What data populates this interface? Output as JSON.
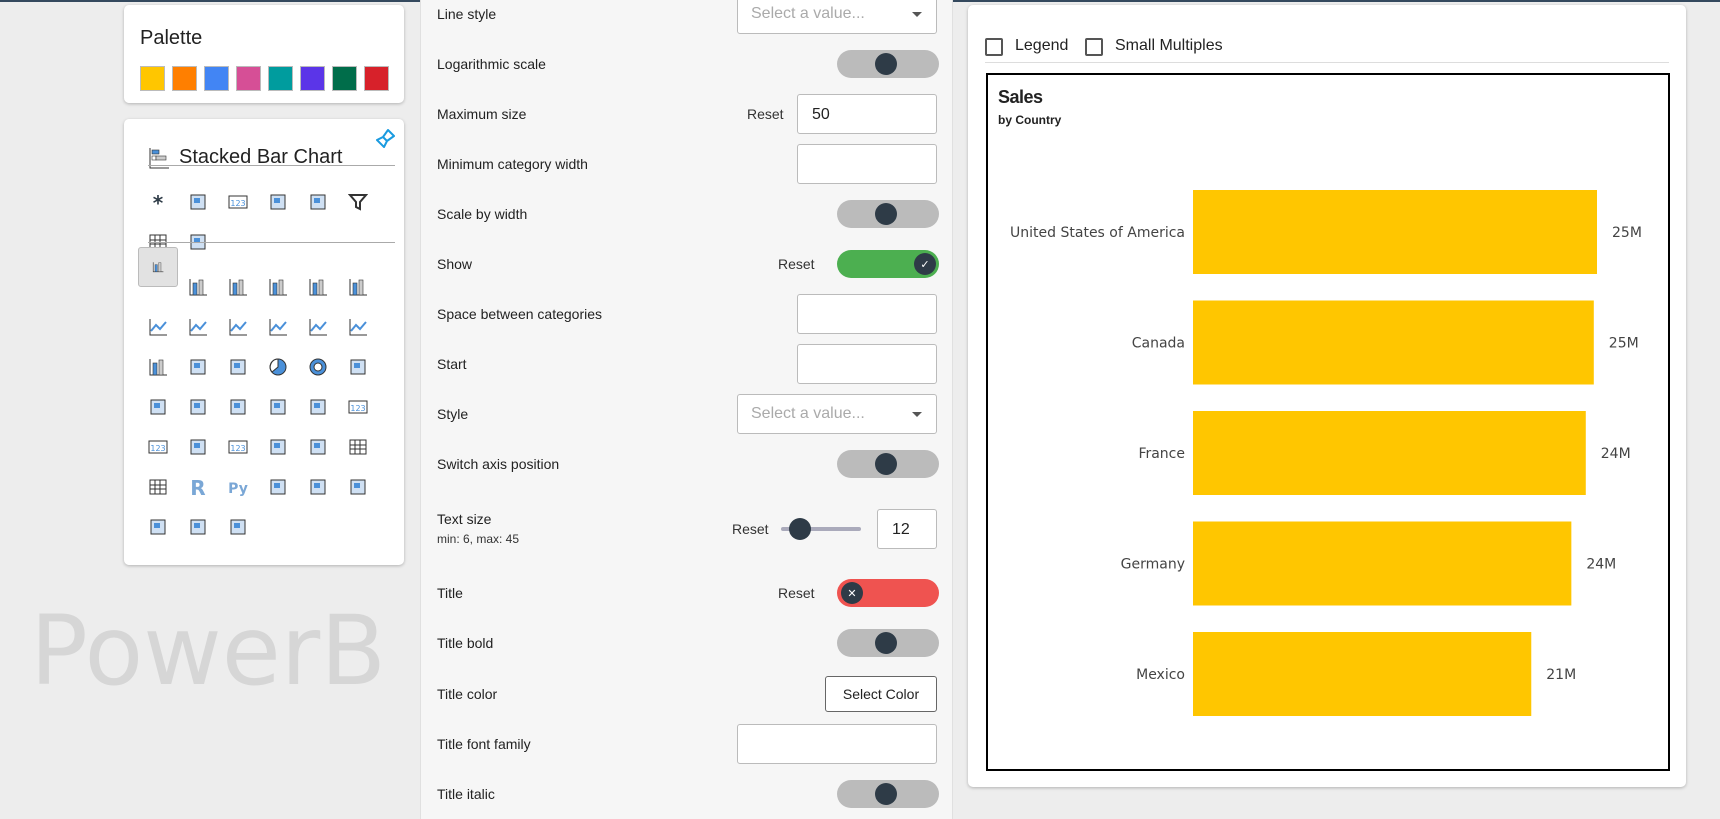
{
  "watermark": "PowerB",
  "palette": {
    "title": "Palette",
    "colors": [
      "#FFC600",
      "#FF7F00",
      "#4285F4",
      "#D64F96",
      "#009C9E",
      "#5B35E8",
      "#006D4A",
      "#D7212A"
    ]
  },
  "visual_picker": {
    "title": "Stacked Bar Chart",
    "title_icon": "stacked-bar-chart-icon",
    "format_icon": "paintbrush-icon",
    "top_icons": [
      "asterisk-icon",
      "shape-icon",
      "qr-card-icon",
      "shapes-icon",
      "button-slicer-icon",
      "filter-icon",
      "matrix-icon",
      "bookmark-icon"
    ],
    "grid_icons": [
      "stacked-bar-icon",
      "stacked-column-icon",
      "clustered-bar-icon",
      "clustered-column-icon",
      "100-stacked-bar-icon",
      "100-stacked-column-icon",
      "line-chart-icon",
      "area-chart-icon",
      "stacked-area-icon",
      "line-clustered-column-icon",
      "line-stacked-column-icon",
      "ribbon-chart-icon",
      "waterfall-icon",
      "funnel-icon",
      "scatter-icon",
      "pie-icon",
      "donut-icon",
      "treemap-icon",
      "map-icon",
      "filled-map-icon",
      "shape-map-icon",
      "azure-map-icon",
      "gauge-icon",
      "card-icon",
      "multi-row-card-icon",
      "kpi-list-icon",
      "kpi-icon",
      "slicer-icon",
      "smart-slicer-icon",
      "table-icon",
      "matrix-table-icon",
      "r-visual-icon",
      "python-visual-icon",
      "key-influencers-icon",
      "decomposition-tree-icon",
      "qa-icon",
      "text-box-icon",
      "trophy-icon",
      "paginated-report-icon"
    ],
    "selected": "stacked-bar-icon"
  },
  "settings": {
    "reset_label": "Reset",
    "select_placeholder": "Select a value...",
    "line_style": "Line style",
    "log_scale": "Logarithmic scale",
    "max_size": "Maximum size",
    "max_size_value": "50",
    "min_cat_width": "Minimum category width",
    "scale_by_width": "Scale by width",
    "show": "Show",
    "space_between": "Space between categories",
    "start": "Start",
    "style": "Style",
    "switch_axis": "Switch axis position",
    "text_size": "Text size",
    "text_size_hint": "min: 6, max: 45",
    "text_size_value": "12",
    "text_size_level": 12,
    "title": "Title",
    "title_bold": "Title bold",
    "title_color": "Title color",
    "select_color": "Select Color",
    "title_font_family": "Title font family",
    "title_italic": "Title italic"
  },
  "chart_panel": {
    "legend_label": "Legend",
    "small_multiples_label": "Small Multiples",
    "legend_checked": false,
    "small_multiples_checked": false
  },
  "chart_data": {
    "type": "bar",
    "orientation": "horizontal",
    "title": "Sales",
    "subtitle": "by Country",
    "categories": [
      "United States of America",
      "Canada",
      "France",
      "Germany",
      "Mexico"
    ],
    "values": [
      25.2,
      25.0,
      24.5,
      23.6,
      21.1
    ],
    "data_labels": [
      "25M",
      "25M",
      "24M",
      "24M",
      "21M"
    ],
    "unit": "M",
    "color": "#FFC600",
    "xlim": [
      0,
      25.2
    ],
    "grid": false,
    "legend": false
  }
}
